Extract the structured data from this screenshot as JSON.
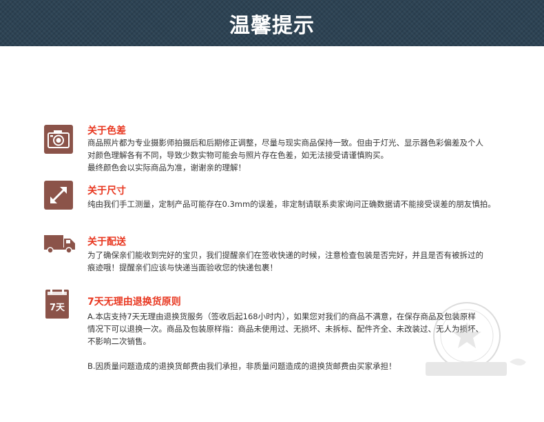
{
  "header": {
    "title": "温馨提示"
  },
  "sections": [
    {
      "icon": "camera-icon",
      "title": "关于色差",
      "lines": [
        "商品照片都为专业摄影师拍摄后和后期修正调整，尽量与现实商品保持一致。但由于灯光、显示器色彩偏差及个人",
        "对颜色理解各有不同，导致少数实物可能会与照片存在色差，如无法接受请谨慎购买。",
        "最终颜色会以实际商品为准，谢谢亲的理解！"
      ]
    },
    {
      "icon": "resize-arrow-icon",
      "title": "关于尺寸",
      "lines": [
        "纯由我们手工测量，定制产品可能存在0.3mm的误差，非定制请联系卖家询问正确数据请不能接受误差的朋友慎拍。"
      ]
    },
    {
      "icon": "truck-icon",
      "title": "关于配送",
      "lines": [
        "为了确保亲们能收到完好的宝贝，我们提醒亲们在签收快递的时候，注意检查包装是否完好，并且是否有被拆过的",
        "痕迹哦！提醒亲们应该与快递当面验收您的快递包裹！"
      ]
    },
    {
      "icon": "calendar-7-days-icon",
      "icon_text": "7天",
      "title": "7天无理由退换货原则",
      "lines": [
        "A.本店支持7天无理由退换货服务（签收后起168小时内），如果您对我们的商品不满意，在保存商品及包装原样",
        "情况下可以退换一次。商品及包装原样指：商品未使用过、无损坏、未拆标、配件齐全、未改装过、无人为损坏、",
        "不影响二次销售。",
        "",
        "B.因质量问题造成的退换货邮费由我们承担，非质量问题造成的退换货邮费由买家承担！"
      ]
    }
  ],
  "colors": {
    "header_bg": "#2d4354",
    "icon_bg": "#8b5349",
    "title_red": "#e8361f",
    "text": "#333333"
  }
}
